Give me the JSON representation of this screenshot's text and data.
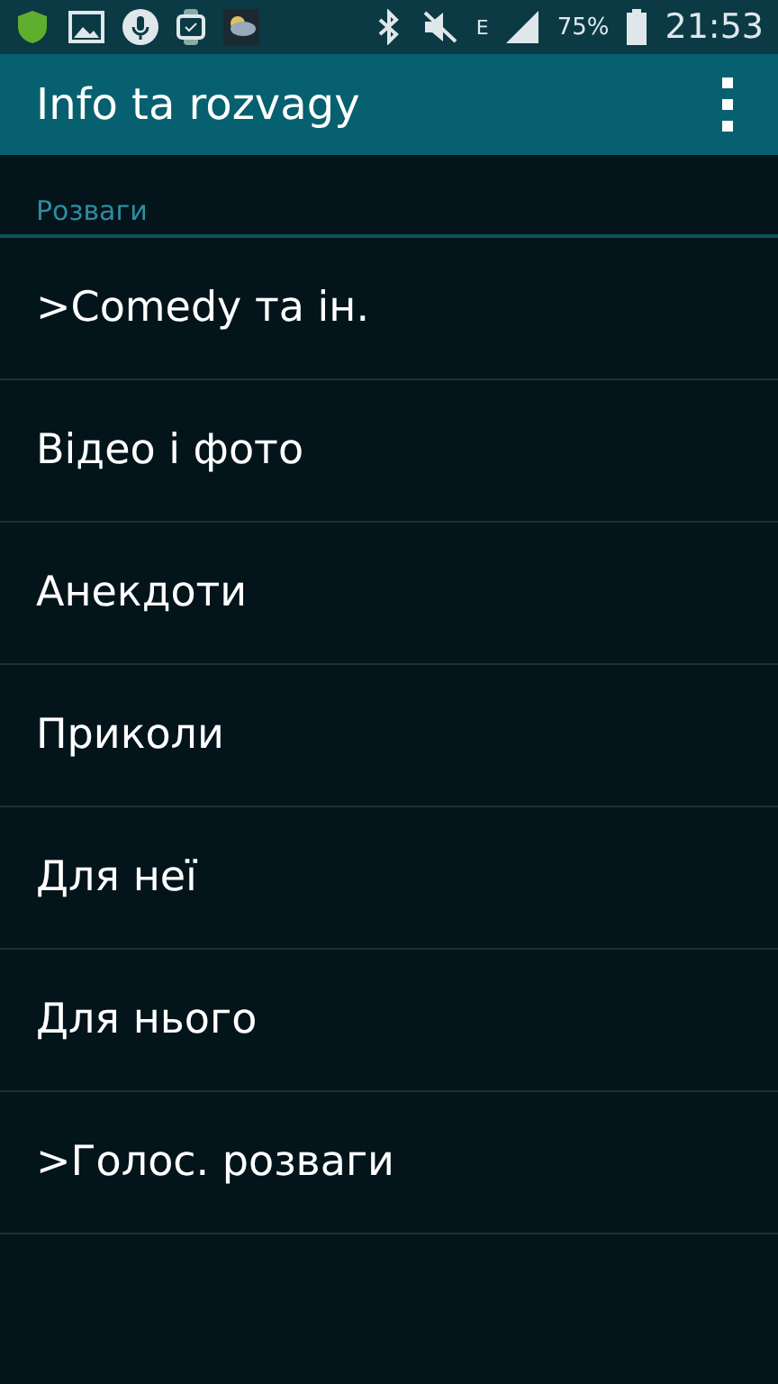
{
  "status_bar": {
    "network_type": "E",
    "battery": "75%",
    "time": "21:53"
  },
  "app_bar": {
    "title": "Info ta rozvagy"
  },
  "section": {
    "title": "Розваги"
  },
  "items": [
    {
      "label": ">Comedy та ін."
    },
    {
      "label": "Відео і фото"
    },
    {
      "label": "Анекдоти"
    },
    {
      "label": "Приколи"
    },
    {
      "label": "Для неї"
    },
    {
      "label": "Для нього"
    },
    {
      "label": ">Голос. розваги"
    }
  ]
}
